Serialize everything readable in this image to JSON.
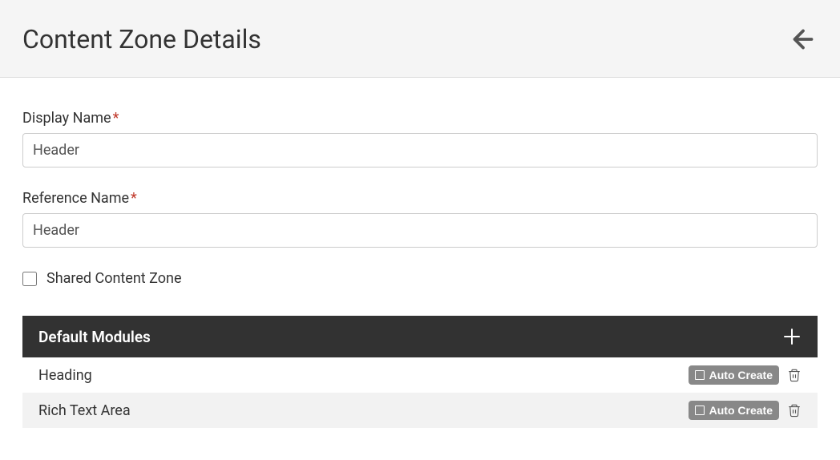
{
  "header": {
    "title": "Content Zone Details"
  },
  "fields": {
    "display_name": {
      "label": "Display Name",
      "value": "Header",
      "required": true
    },
    "reference_name": {
      "label": "Reference Name",
      "value": "Header",
      "required": true
    },
    "shared_content_zone": {
      "label": "Shared Content Zone",
      "checked": false
    }
  },
  "modules_section": {
    "title": "Default Modules",
    "auto_create_label": "Auto Create",
    "items": [
      {
        "name": "Heading"
      },
      {
        "name": "Rich Text Area"
      }
    ]
  }
}
